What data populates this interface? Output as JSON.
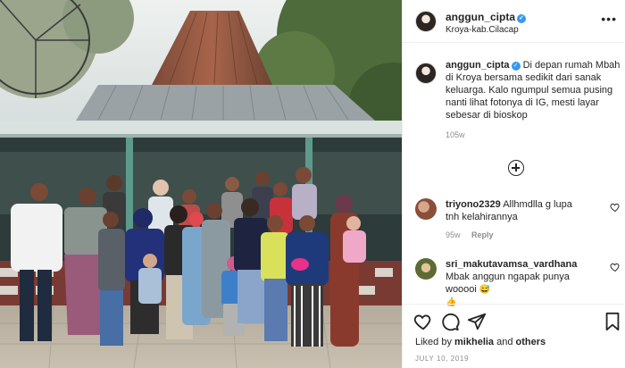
{
  "post": {
    "username": "anggun_cipta",
    "location": "Kroya-kab.Cilacap",
    "more_label": "•••",
    "verified_glyph": "✓"
  },
  "caption": {
    "username": "anggun_cipta",
    "text": "Di depan rumah Mbah di Kroya bersama sedikit dari sanak keluarga. Kalo ngumpul semua pusing nanti lihat fotonya di IG, mesti layar sebesar di bioskop",
    "time": "105w"
  },
  "comments": [
    {
      "username": "triyono2329",
      "text": "Allhmdlla g lupa",
      "text_cont": "tnh kelahirannya",
      "time": "95w",
      "reply_label": "Reply",
      "avatar_color": "#b07a5a"
    },
    {
      "username": "sri_makutavamsa_vardhana",
      "text": "Mbak anggun ngapak punya wooooi",
      "emoji1": "😅",
      "emoji2": "👍",
      "avatar_color": "#6b7a3a"
    }
  ],
  "footer": {
    "liked_prefix": "Liked by ",
    "liked_user": "mikhelia",
    "liked_mid": " and ",
    "liked_others": "others",
    "date": "JULY 10, 2019"
  },
  "icons": {
    "like": "heart-icon",
    "comment": "comment-icon",
    "share": "share-icon",
    "save": "bookmark-icon",
    "load_more": "plus-circle-icon"
  },
  "colors": {
    "verified": "#3897f0",
    "muted": "#8e8e8e",
    "text": "#262626",
    "border": "#efefef"
  }
}
